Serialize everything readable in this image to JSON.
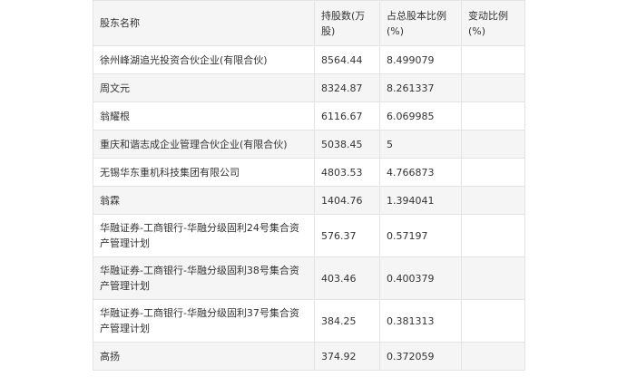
{
  "table": {
    "headers": [
      "股东名称",
      "持股数(万股)",
      "占总股本比例(%)",
      "变动比例(%)"
    ],
    "rows": [
      {
        "name": "徐州峰湖追光投资合伙企业(有限合伙)",
        "shares": "8564.44",
        "ratio": "8.499079",
        "change": ""
      },
      {
        "name": "周文元",
        "shares": "8324.87",
        "ratio": "8.261337",
        "change": ""
      },
      {
        "name": "翁耀根",
        "shares": "6116.67",
        "ratio": "6.069985",
        "change": ""
      },
      {
        "name": "重庆和谐志成企业管理合伙企业(有限合伙)",
        "shares": "5038.45",
        "ratio": "5",
        "change": ""
      },
      {
        "name": "无锡华东重机科技集团有限公司",
        "shares": "4803.53",
        "ratio": "4.766873",
        "change": ""
      },
      {
        "name": "翁霖",
        "shares": "1404.76",
        "ratio": "1.394041",
        "change": ""
      },
      {
        "name": "华融证券-工商银行-华融分级固利24号集合资产管理计划",
        "shares": "576.37",
        "ratio": "0.57197",
        "change": ""
      },
      {
        "name": "华融证券-工商银行-华融分级固利38号集合资产管理计划",
        "shares": "403.46",
        "ratio": "0.400379",
        "change": ""
      },
      {
        "name": "华融证券-工商银行-华融分级固利37号集合资产管理计划",
        "shares": "384.25",
        "ratio": "0.381313",
        "change": ""
      },
      {
        "name": "高扬",
        "shares": "374.92",
        "ratio": "0.372059",
        "change": ""
      }
    ]
  }
}
